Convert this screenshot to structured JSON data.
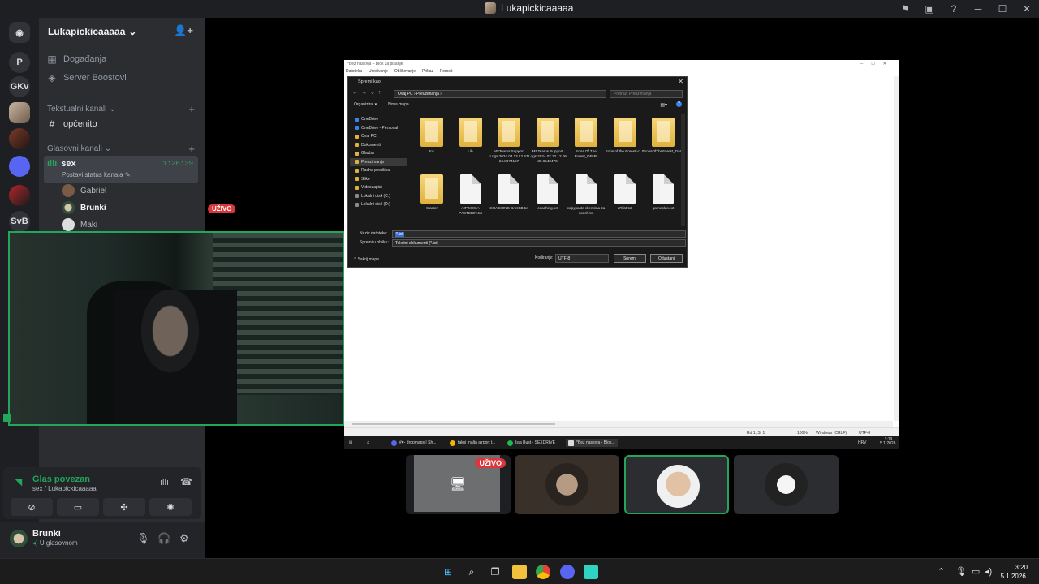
{
  "window": {
    "title": "Lukapickicaaaaa"
  },
  "guilds": [
    {
      "label": "P"
    },
    {
      "label": "GKv"
    },
    {
      "label": "SvB"
    }
  ],
  "server": {
    "name": "Lukapickicaaaaa"
  },
  "nav": [
    {
      "label": "Događanja"
    },
    {
      "label": "Server Boostovi"
    }
  ],
  "text_category": "Tekstualni kanali",
  "text_channels": [
    {
      "label": "općenito"
    }
  ],
  "voice_category": "Glasovni kanali",
  "voice_channel": {
    "name": "sex",
    "timer": "1:26:39",
    "status": "Postavi status kanala"
  },
  "voice_users": [
    {
      "name": "Gabriel",
      "badge": "UŽIVO"
    },
    {
      "name": "Brunki"
    },
    {
      "name": "Maki"
    }
  ],
  "voice_panel": {
    "title": "Glas povezan",
    "subtitle": "sex / Lukapickicaaaaa"
  },
  "user_bar": {
    "name": "Brunki",
    "status": "U glasovnom"
  },
  "notepad": {
    "title": "*Bez naslova – Blok za pisanje",
    "menu": [
      "Datoteka",
      "Uređivanje",
      "Oblikovanje",
      "Prikaz",
      "Pomoć"
    ],
    "status": [
      "Rd 1, St 1",
      "100%",
      "Windows (CRLF)",
      "UTF-8"
    ]
  },
  "save_dialog": {
    "title": "Spremi kao",
    "address": "Ovaj PC  ›  Preuzimanja  ›",
    "search_placeholder": "Pretraži Preuzimanja",
    "organize": "Organiziraj ▾",
    "new_folder": "Nova mapa",
    "tree": [
      "OneDrive",
      "OneDrive - Personal",
      "Ovaj PC",
      "Dokumenti",
      "Glazba",
      "Preuzimanja",
      "Radna površina",
      "Slike",
      "Videozapisi",
      "Lokalni disk (C:)",
      "Lokalni disk (D:)"
    ],
    "files": [
      {
        "name": "Inc",
        "type": "folder"
      },
      {
        "name": "Lib",
        "type": "folder"
      },
      {
        "name": "MSTeams Support Logs 2024.03.13 12.57 24.8874157",
        "type": "folder"
      },
      {
        "name": "MSTeams Support Logs 2024.07.22 12.06 30.6540470",
        "type": "folder"
      },
      {
        "name": "Sons Of The Forest_DFME",
        "type": "folder"
      },
      {
        "name": "Sons.of.the.Forest.v1.0",
        "type": "folder"
      },
      {
        "name": "SonsOfTheForest_Data",
        "type": "folder"
      },
      {
        "name": "Starter",
        "type": "folder"
      },
      {
        "name": "AIP MEGA PASTEBIN.txt",
        "type": "doc"
      },
      {
        "name": "COACHING BAKBB.txt",
        "type": "doc"
      },
      {
        "name": "coaching.txt",
        "type": "doc"
      },
      {
        "name": "copypaste clientima za coach.txt",
        "type": "doc"
      },
      {
        "name": "dRlist.txt",
        "type": "doc"
      },
      {
        "name": "gameplan.txt",
        "type": "doc"
      }
    ],
    "filename_label": "Naziv datoteke:",
    "filename_value": "*.txt",
    "type_label": "Spremi u obliku:",
    "type_value": "Tekstni dokumenti (*.txt)",
    "hide_folders": "Sakrij mape",
    "encoding_label": "Kodiranje:",
    "encoding_value": "UTF-8",
    "save": "Spremi",
    "cancel": "Odustani"
  },
  "inner_taskbar": {
    "items": [
      "#♥- dropmaps | Sh...",
      "taksi malta airport t...",
      "Isla Bust - SEXDRIVE",
      "*Bez naslova - Blok..."
    ],
    "lang": "HRV",
    "time": "3:19",
    "date": "5.1.2026."
  },
  "tile_badge": "UŽIVO",
  "taskbar": {
    "time": "3:20",
    "date": "5.1.2026."
  }
}
